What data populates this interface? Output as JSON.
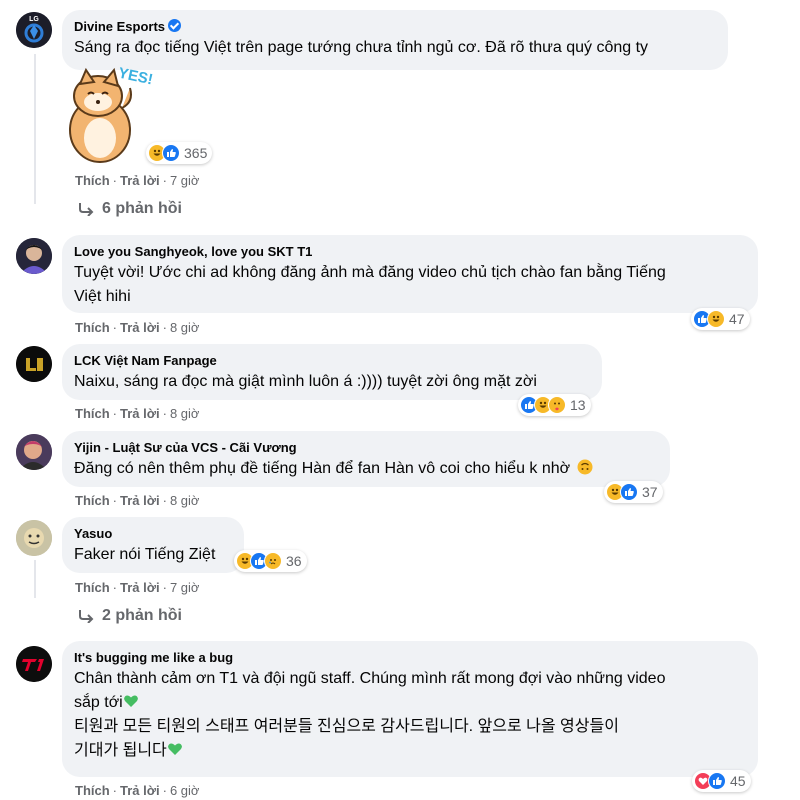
{
  "comments": [
    {
      "author": "Divine Esports",
      "text": "Sáng ra đọc tiếng Việt trên page tướng chưa tỉnh ngủ cơ. Đã rõ thưa quý công ty",
      "reaction_count": "365",
      "like_label": "Thích",
      "reply_label": "Trả lời",
      "time": "7 giờ",
      "replies_label": "6 phản hồi",
      "sticker_text": "YES!",
      "avatar_text": "LG"
    },
    {
      "author": "Love you Sanghyeok, love you SKT T1",
      "text_line1": "Tuyệt vời! Ước chi ad không đăng ảnh mà đăng video chủ tịch chào fan bằng Tiếng",
      "text_line2": "Việt hihi",
      "reaction_count": "47",
      "like_label": "Thích",
      "reply_label": "Trả lời",
      "time": "8 giờ"
    },
    {
      "author": "LCK Việt Nam Fanpage",
      "text": "Naixu, sáng ra đọc mà giật mình luôn á :)))) tuyệt zời ông mặt zời",
      "reaction_count": "13",
      "like_label": "Thích",
      "reply_label": "Trả lời",
      "time": "8 giờ"
    },
    {
      "author": "Yijin - Luật Sư của VCS - Cãi Vương",
      "text": "Đăng có nên thêm phụ đề tiếng Hàn để fan Hàn vô coi cho hiểu k nhờ",
      "reaction_count": "37",
      "like_label": "Thích",
      "reply_label": "Trả lời",
      "time": "8 giờ"
    },
    {
      "author": "Yasuo",
      "text": "Faker nói Tiếng Ziệt",
      "reaction_count": "36",
      "like_label": "Thích",
      "reply_label": "Trả lời",
      "time": "7 giờ",
      "replies_label": "2 phản hồi"
    },
    {
      "author": "It's bugging me like a bug",
      "text_line1": "Chân thành cảm ơn T1 và đội ngũ staff. Chúng mình rất mong đợi vào những video",
      "text_line2": "sắp tới",
      "text_line3": "티원과 모든 티원의 스태프 여러분들 진심으로 감사드립니다. 앞으로 나올 영상들이",
      "text_line4": "기대가 됩니다",
      "reaction_count": "45",
      "like_label": "Thích",
      "reply_label": "Trả lời",
      "time": "6 giờ",
      "avatar_text": "T1"
    }
  ],
  "colors": {
    "bubble_bg": "#f0f2f5",
    "link_gray": "#65676b",
    "like_blue": "#1877f2",
    "haha_yellow": "#f7b928",
    "love_red": "#f33e58",
    "green_heart": "#45bd62"
  }
}
